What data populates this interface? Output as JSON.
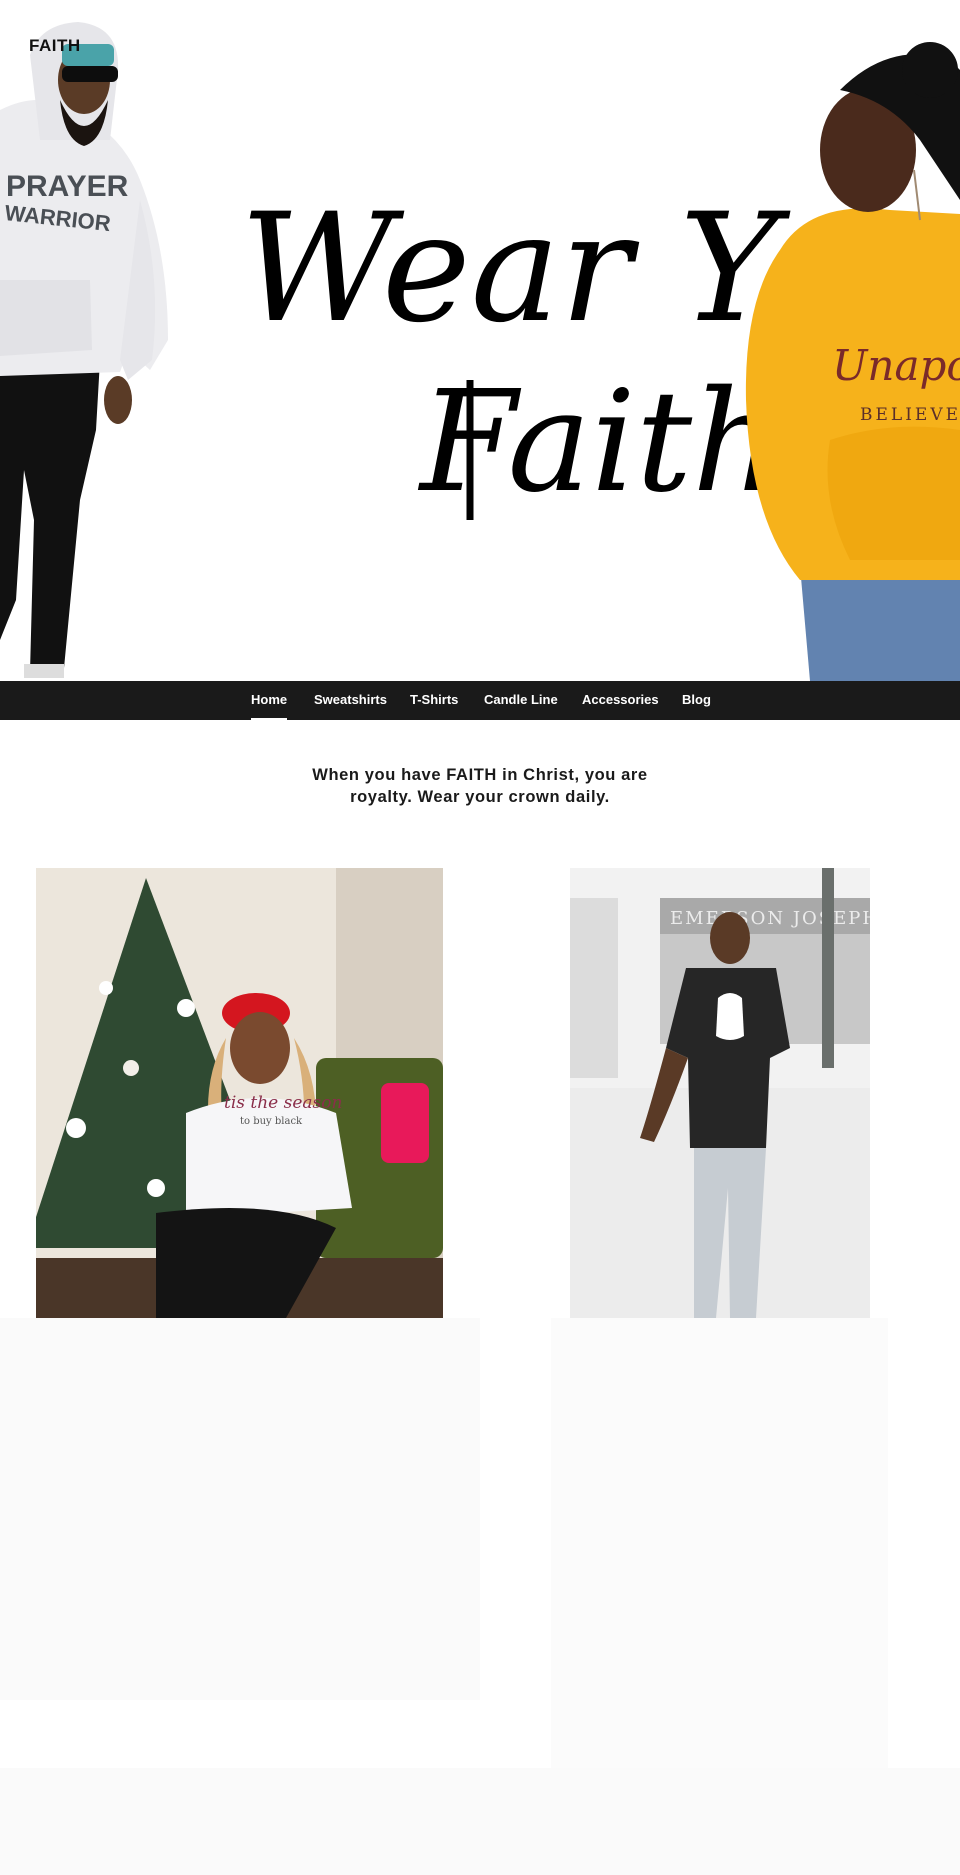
{
  "header": {
    "logo_text": "FAITH",
    "hero_script_line1": "Wear Your",
    "hero_script_line2": "Faith",
    "left_model_shirt_line1": "PRAYER",
    "left_model_shirt_line2": "WARRIOR",
    "right_model_shirt_line1": "Unapologe",
    "right_model_shirt_line2": "BELIEVER"
  },
  "nav": {
    "items": [
      {
        "label": "Home",
        "active": true
      },
      {
        "label": "Sweatshirts",
        "active": false
      },
      {
        "label": "T-Shirts",
        "active": false
      },
      {
        "label": "Candle Line",
        "active": false
      },
      {
        "label": "Accessories",
        "active": false
      },
      {
        "label": "Blog",
        "active": false
      }
    ]
  },
  "tagline": {
    "line1": "When you have FAITH in Christ, you are",
    "line2": "royalty. Wear your crown daily."
  },
  "products": [
    {
      "shirt_text_line1": "tis the season",
      "shirt_text_line2": "to buy black",
      "icon": "christmas-tree-icon"
    },
    {
      "sign_text": "EMERSON JOSEPH",
      "icon": "raised-fist-icon"
    }
  ],
  "colors": {
    "nav_bg": "#1a1a1a",
    "nav_text": "#ffffff",
    "hoodie_yellow": "#f6b21b",
    "hoodie_white": "#ececef",
    "beret_red": "#d4161f"
  }
}
